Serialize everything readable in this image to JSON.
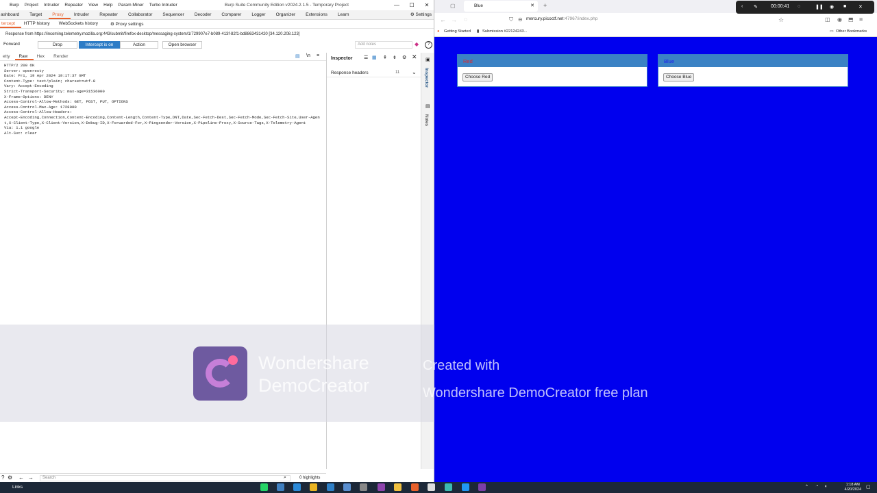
{
  "burp": {
    "menu": [
      "Burp",
      "Project",
      "Intruder",
      "Repeater",
      "View",
      "Help",
      "Param Miner",
      "Turbo Intruder"
    ],
    "window_title": "Burp Suite Community Edition v2024.2.1.5 - Temporary Project",
    "window_controls": [
      "—",
      "☐",
      "✕"
    ],
    "main_tabs": [
      "ashboard",
      "Target",
      "Proxy",
      "Intruder",
      "Repeater",
      "Collaborator",
      "Sequencer",
      "Decoder",
      "Comparer",
      "Logger",
      "Organizer",
      "Extensions",
      "Learn"
    ],
    "settings": "Settings",
    "proxy_tabs": [
      "tercept",
      "HTTP history",
      "WebSockets history",
      "Proxy settings"
    ],
    "response_from": "Response from https://incoming.telemetry.mozilla.org:443/submit/firefox-desktop/messaging-system/1/729907e7-b089-413f-82f1-bd8863431420  [34.120.208.123]",
    "buttons": {
      "forward": "Forward",
      "drop": "Drop",
      "intercept": "Intercept is on",
      "action": "Action",
      "open_browser": "Open browser"
    },
    "notes_placeholder": "Add notes",
    "view_tabs": [
      "etty",
      "Raw",
      "Hex",
      "Render"
    ],
    "code_lines": [
      "HTTP/2 200 OK",
      "Server: openresty",
      "Date: Fri, 19 Apr 2024 19:17:37 GMT",
      "Content-Type: text/plain; charset=utf-8",
      "Vary: Accept-Encoding",
      "Strict-Transport-Security: max-age=31536000",
      "X-Frame-Options: DENY",
      "Access-Control-Allow-Methods: GET, POST, PUT, OPTIONS",
      "Access-Control-Max-Age: 1728000",
      "Access-Control-Allow-Headers:",
      "Accept-Encoding,Connection,Content-Encoding,Content-Length,Content-Type,DNT,Date,Sec-Fetch-Dest,Sec-Fetch-Mode,Sec-Fetch-Site,User-Agent,X-Client-Type,X-Client-Version,X-Debug-ID,X-Forwarded-For,X-Pingsender-Version,X-Pipeline-Proxy,X-Source-Tags,X-Telemetry-Agent",
      "Via: 1.1 google",
      "Alt-Svc: clear"
    ],
    "inspector": {
      "title": "Inspector",
      "section": "Response headers",
      "count": "11"
    },
    "sidebar": {
      "inspector": "Inspector",
      "notes": "Notes"
    },
    "search_placeholder": "Search",
    "highlights": "0 highlights"
  },
  "firefox": {
    "tab_title": "Blue",
    "url_domain": "mercury.picoctf.net",
    "url_rest": ":47967/index.php",
    "url_prefix": "",
    "bookmarks": [
      "Getting Started",
      "Submission #22124243..."
    ],
    "other_bookmarks": "Other Bookmarks",
    "red_card": {
      "title": "Red",
      "button": "Choose Red"
    },
    "blue_card": {
      "title": "Blue",
      "button": "Choose Blue"
    },
    "page_bg": "#0000ee"
  },
  "recorder": {
    "time": "00:00:41"
  },
  "watermark": {
    "brand_line1": "Wondershare",
    "brand_line2": "DemoCreator",
    "created_line1": "Created with",
    "created_line2": "Wondershare DemoCreator free plan"
  },
  "taskbar": {
    "links": "Links",
    "time": "1:18 AM",
    "date": "4/20/2024"
  }
}
